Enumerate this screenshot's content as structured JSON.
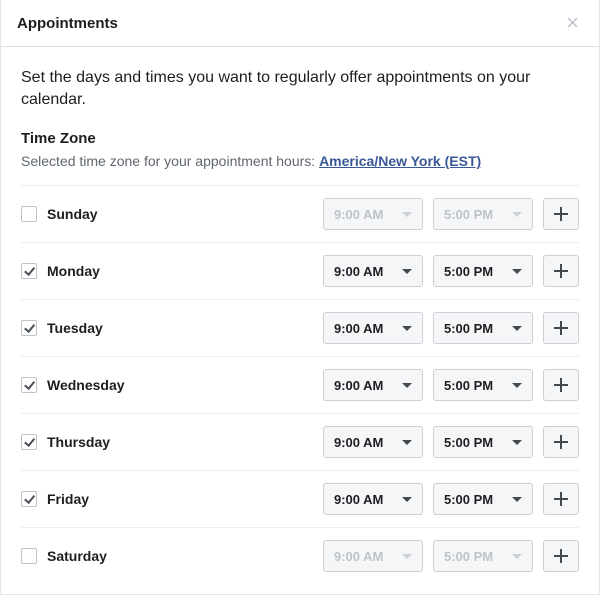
{
  "header": {
    "title": "Appointments",
    "close_label": "×"
  },
  "description": "Set the days and times you want to regularly offer appointments on your calendar.",
  "timezone": {
    "title": "Time Zone",
    "desc_prefix": "Selected time zone for your appointment hours: ",
    "value": "America/New York (EST)"
  },
  "days": [
    {
      "name": "Sunday",
      "checked": false,
      "start": "9:00 AM",
      "end": "5:00 PM"
    },
    {
      "name": "Monday",
      "checked": true,
      "start": "9:00 AM",
      "end": "5:00 PM"
    },
    {
      "name": "Tuesday",
      "checked": true,
      "start": "9:00 AM",
      "end": "5:00 PM"
    },
    {
      "name": "Wednesday",
      "checked": true,
      "start": "9:00 AM",
      "end": "5:00 PM"
    },
    {
      "name": "Thursday",
      "checked": true,
      "start": "9:00 AM",
      "end": "5:00 PM"
    },
    {
      "name": "Friday",
      "checked": true,
      "start": "9:00 AM",
      "end": "5:00 PM"
    },
    {
      "name": "Saturday",
      "checked": false,
      "start": "9:00 AM",
      "end": "5:00 PM"
    }
  ]
}
